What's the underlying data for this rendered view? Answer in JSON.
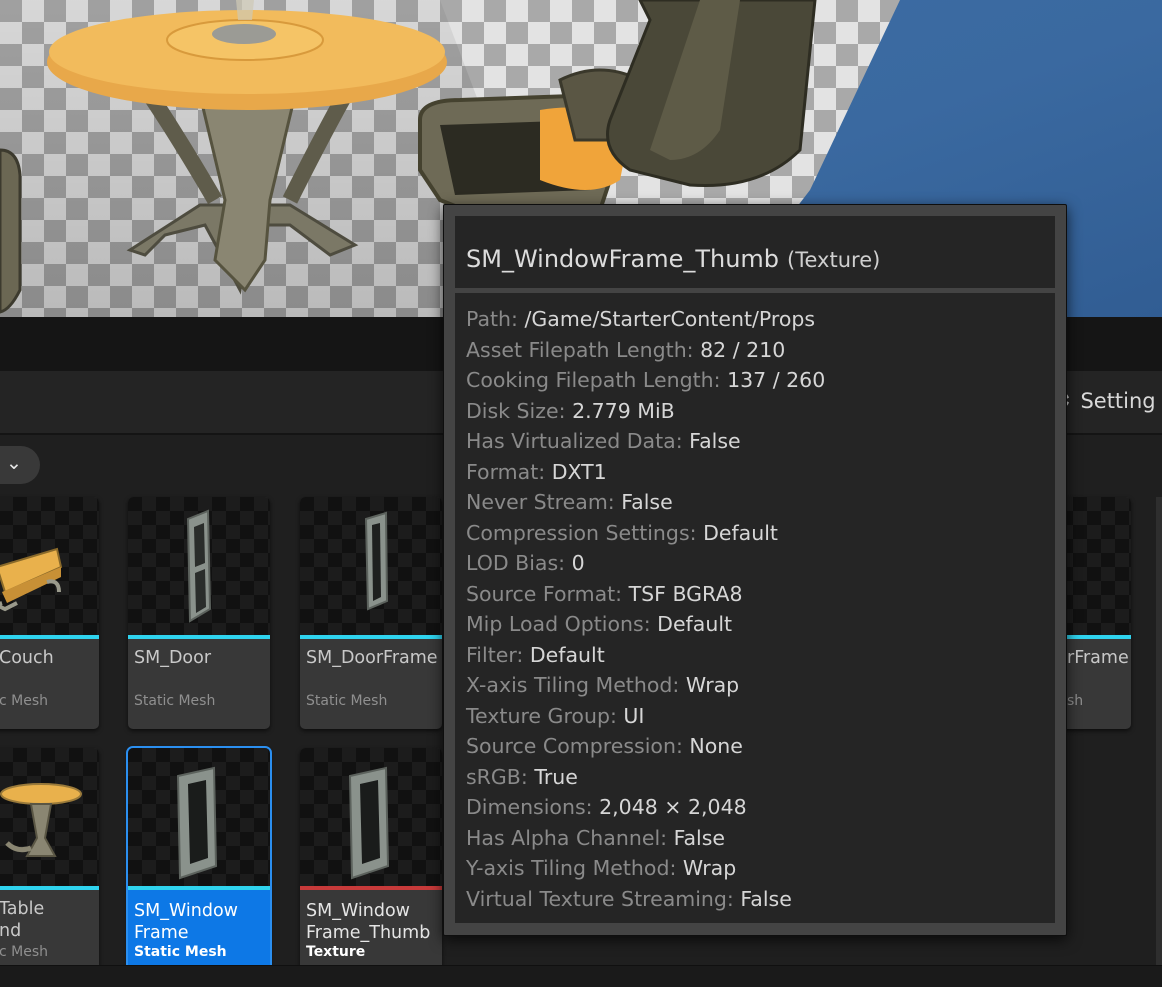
{
  "toolbar": {
    "settings_label": "Setting"
  },
  "tiles": [
    {
      "name": "Couch",
      "type": "c Mesh"
    },
    {
      "name": "SM_Door",
      "type": "Static Mesh"
    },
    {
      "name": "SM_DoorFrame",
      "type": "Static Mesh"
    },
    {
      "name": "rFrame",
      "type": "sh"
    },
    {
      "name": "Table\nnd",
      "type": "c Mesh"
    },
    {
      "name": "SM_Window\nFrame",
      "type": "Static Mesh"
    },
    {
      "name": "SM_Window\nFrame_Thumb",
      "type": "Texture"
    }
  ],
  "tooltip": {
    "title": "SM_WindowFrame_Thumb",
    "kind": "(Texture)",
    "rows": [
      {
        "key": "Path:",
        "value": "/Game/StarterContent/Props"
      },
      {
        "key": "Asset Filepath Length:",
        "value": "82 / 210"
      },
      {
        "key": "Cooking Filepath Length:",
        "value": "137 / 260"
      },
      {
        "key": "Disk Size:",
        "value": "2.779 MiB"
      },
      {
        "key": "Has Virtualized Data:",
        "value": "False"
      },
      {
        "key": "Format:",
        "value": "DXT1"
      },
      {
        "key": "Never Stream:",
        "value": "False"
      },
      {
        "key": "Compression Settings:",
        "value": "Default"
      },
      {
        "key": "LOD Bias:",
        "value": "0"
      },
      {
        "key": "Source Format:",
        "value": "TSF BGRA8"
      },
      {
        "key": "Mip Load Options:",
        "value": "Default"
      },
      {
        "key": "Filter:",
        "value": "Default"
      },
      {
        "key": "X-axis Tiling Method:",
        "value": "Wrap"
      },
      {
        "key": "Texture Group:",
        "value": "UI"
      },
      {
        "key": "Source Compression:",
        "value": "None"
      },
      {
        "key": "sRGB:",
        "value": "True"
      },
      {
        "key": "Dimensions:",
        "value": "2,048 × 2,048"
      },
      {
        "key": "Has Alpha Channel:",
        "value": "False"
      },
      {
        "key": "Y-axis Tiling Method:",
        "value": "Wrap"
      },
      {
        "key": "Virtual Texture Streaming:",
        "value": "False"
      }
    ]
  },
  "colors": {
    "selection": "#0d78e6",
    "static_mesh_stripe": "#2fd3ee",
    "texture_stripe": "#c73a3a"
  }
}
